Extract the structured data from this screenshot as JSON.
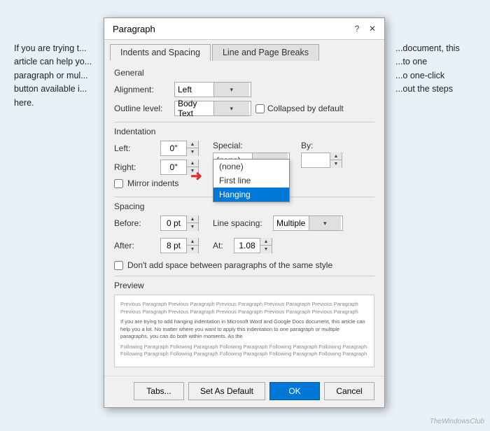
{
  "background": {
    "left_text": "If you are trying t... article can help yo... paragraph or mul... button available i... here.",
    "right_text": "...locument, this ...o one ...oo one-click ...out the steps"
  },
  "dialog": {
    "title": "Paragraph",
    "help_btn": "?",
    "close_btn": "✕",
    "tabs": [
      {
        "label": "Indents and Spacing",
        "active": true
      },
      {
        "label": "Line and Page Breaks",
        "active": false
      }
    ],
    "general": {
      "label": "General",
      "alignment_label": "Alignment:",
      "alignment_value": "Left",
      "outline_label": "Outline level:",
      "outline_value": "Body Text",
      "collapsed_label": "Collapsed by default"
    },
    "indentation": {
      "label": "Indentation",
      "left_label": "Left:",
      "left_value": "0\"",
      "right_label": "Right:",
      "right_value": "0\"",
      "special_label": "Special:",
      "by_label": "By:",
      "mirror_label": "Mirror indents",
      "special_dropdown": {
        "options": [
          "(none)",
          "First line",
          "Hanging"
        ],
        "selected": 2,
        "open": true
      }
    },
    "spacing": {
      "label": "Spacing",
      "before_label": "Before:",
      "before_value": "0 pt",
      "after_label": "After:",
      "after_value": "8 pt",
      "line_spacing_label": "Line spacing:",
      "line_spacing_value": "Multiple",
      "at_label": "At:",
      "at_value": "1.08",
      "no_space_label": "Don't add space between paragraphs of the same style"
    },
    "preview": {
      "label": "Preview",
      "preview_para1": "Previous Paragraph Previous Paragraph Previous Paragraph Previous Paragraph Previous Paragraph Previous Paragraph Previous Paragraph Previous Paragraph Previous Paragraph Previous Paragraph",
      "preview_main": "If you are trying to add hanging indentation in Microsoft Word and Google Docs document, this article can help you a lot. No matter where you want to apply this indentation to one paragraph or multiple paragraphs, you can do both within moments. As the",
      "preview_para2": "Following Paragraph Following Paragraph Following Paragraph Following Paragraph Following Paragraph Following Paragraph Following Paragraph Following Paragraph Following Paragraph Following Paragraph"
    },
    "buttons": {
      "tabs_label": "Tabs...",
      "default_label": "Set As Default",
      "ok_label": "OK",
      "cancel_label": "Cancel"
    }
  },
  "watermark": "TheWindowsClub"
}
